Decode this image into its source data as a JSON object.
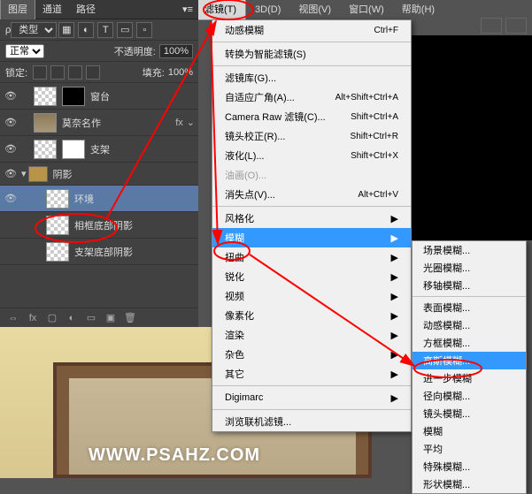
{
  "menubar": {
    "filter": "滤镜(T)",
    "threeD": "3D(D)",
    "view": "视图(V)",
    "window": "窗口(W)",
    "help": "帮助(H)"
  },
  "panel": {
    "tabs": {
      "layers": "图层",
      "channels": "通道",
      "paths": "路径"
    },
    "typeLabel": "类型",
    "iconT": "T",
    "blendMode": "正常",
    "opacityLabel": "不透明度:",
    "opacityVal": "100%",
    "lockLabel": "锁定:",
    "fillLabel": "填充:",
    "fillVal": "100%",
    "layers": [
      {
        "name": "窗台"
      },
      {
        "name": "莫奈名作"
      },
      {
        "name": "支架"
      },
      {
        "name": "阴影",
        "group": true
      },
      {
        "name": "环境",
        "selected": true
      },
      {
        "name": "相框底部阴影"
      },
      {
        "name": "支架底部阴影"
      }
    ],
    "fxLabel": "fx"
  },
  "menu1": {
    "motionBlur": "动感模糊",
    "motionBlurSc": "Ctrl+F",
    "convertSmart": "转换为智能滤镜(S)",
    "filterGallery": "滤镜库(G)...",
    "adaptiveWide": "自适应广角(A)...",
    "adaptiveWideSc": "Alt+Shift+Ctrl+A",
    "cameraRaw": "Camera Raw 滤镜(C)...",
    "cameraRawSc": "Shift+Ctrl+A",
    "lensCorrect": "镜头校正(R)...",
    "lensCorrectSc": "Shift+Ctrl+R",
    "liquify": "液化(L)...",
    "liquifySc": "Shift+Ctrl+X",
    "oilPaint": "油画(O)...",
    "vanishing": "消失点(V)...",
    "vanishingSc": "Alt+Ctrl+V",
    "stylize": "风格化",
    "blur": "模糊",
    "distort": "扭曲",
    "sharpen": "锐化",
    "video": "视频",
    "pixelate": "像素化",
    "render": "渲染",
    "noise": "杂色",
    "other": "其它",
    "digimarc": "Digimarc",
    "browseOnline": "浏览联机滤镜..."
  },
  "menu2": {
    "fieldBlur": "场景模糊...",
    "irisBlur": "光圈模糊...",
    "tiltShift": "移轴模糊...",
    "surfaceBlur": "表面模糊...",
    "motionBlur": "动感模糊...",
    "boxBlur": "方框模糊...",
    "gaussianBlur": "高斯模糊...",
    "furtherBlur": "进一步模糊",
    "radialBlur": "径向模糊...",
    "lensBlur": "镜头模糊...",
    "blur": "模糊",
    "average": "平均",
    "specialBlur": "特殊模糊...",
    "shapeBlur": "形状模糊..."
  },
  "watermark": "WWW.PSAHZ.COM"
}
